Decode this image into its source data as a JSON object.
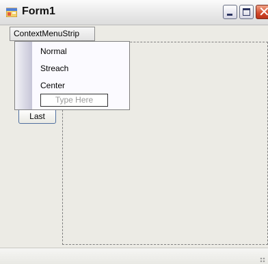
{
  "window": {
    "title": "Form1"
  },
  "menu_strip": {
    "label": "ContextMenuStrip"
  },
  "context_menu": {
    "items": [
      "Normal",
      "Streach",
      "Center"
    ],
    "type_here_placeholder": "Type Here"
  },
  "buttons": {
    "last_label": "Last"
  },
  "icons": {
    "app": "form-icon",
    "minimize": "minimize-icon",
    "maximize": "maximize-icon",
    "close": "close-icon"
  }
}
